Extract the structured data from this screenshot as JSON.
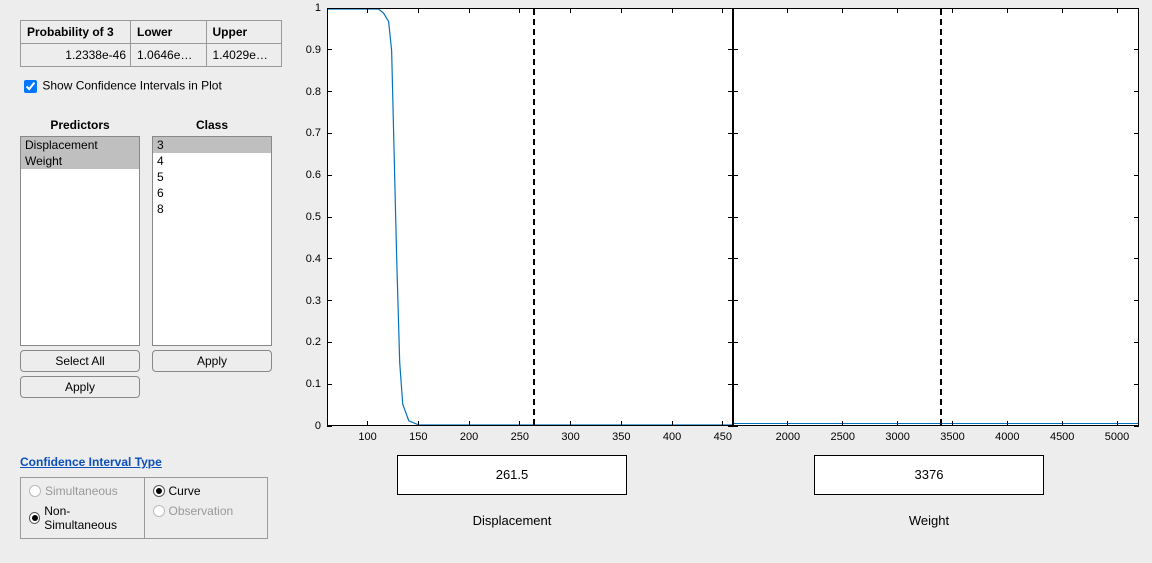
{
  "prob_table": {
    "headers": [
      "Probability of 3",
      "Lower",
      "Upper"
    ],
    "row": [
      "1.2338e-46",
      "1.0646e…",
      "1.4029e…"
    ]
  },
  "show_ci": {
    "label": "Show Confidence Intervals in Plot",
    "checked": true
  },
  "predictors": {
    "header": "Predictors",
    "items": [
      "Displacement",
      "Weight"
    ],
    "selected": [
      0,
      1
    ],
    "select_all": "Select All",
    "apply": "Apply"
  },
  "class": {
    "header": "Class",
    "items": [
      "3",
      "4",
      "5",
      "6",
      "8"
    ],
    "selected": [
      0
    ],
    "apply": "Apply"
  },
  "ci": {
    "title": "Confidence Interval Type",
    "left": {
      "simultaneous": {
        "label": "Simultaneous",
        "checked": false,
        "disabled": true
      },
      "nonsimultaneous": {
        "label": "Non-Simultaneous",
        "checked": true,
        "disabled": false
      }
    },
    "right": {
      "curve": {
        "label": "Curve",
        "checked": true,
        "disabled": false
      },
      "observation": {
        "label": "Observation",
        "checked": false,
        "disabled": true
      }
    }
  },
  "plots": {
    "yticks": [
      0,
      0.1,
      0.2,
      0.3,
      0.4,
      0.5,
      0.6,
      0.7,
      0.8,
      0.9,
      1
    ],
    "disp": {
      "label": "Displacement",
      "value": "261.5",
      "range": [
        60,
        460
      ],
      "xticks": [
        100,
        150,
        200,
        250,
        300,
        350,
        400,
        450
      ],
      "ref": 261.5
    },
    "weight": {
      "label": "Weight",
      "value": "3376",
      "range": [
        1500,
        5200
      ],
      "xticks": [
        2000,
        2500,
        3000,
        3500,
        4000,
        4500,
        5000
      ],
      "ref": 3376
    }
  },
  "chart_data": [
    {
      "type": "line",
      "title": "",
      "xlabel": "Displacement",
      "ylabel": "Probability of 3",
      "ylim": [
        0,
        1
      ],
      "xlim": [
        60,
        460
      ],
      "x": [
        60,
        90,
        110,
        115,
        120,
        123,
        126,
        128,
        131,
        134,
        140,
        150,
        180,
        260,
        460
      ],
      "y": [
        1.0,
        1.0,
        1.0,
        0.99,
        0.97,
        0.9,
        0.6,
        0.4,
        0.15,
        0.05,
        0.01,
        0.0,
        0.0,
        0.0,
        0.0
      ],
      "reference_x": 261.5
    },
    {
      "type": "line",
      "title": "",
      "xlabel": "Weight",
      "ylabel": "Probability of 3",
      "ylim": [
        0,
        1
      ],
      "xlim": [
        1500,
        5200
      ],
      "x": [
        1500,
        5200
      ],
      "y": [
        0.0,
        0.0
      ],
      "reference_x": 3376
    }
  ]
}
